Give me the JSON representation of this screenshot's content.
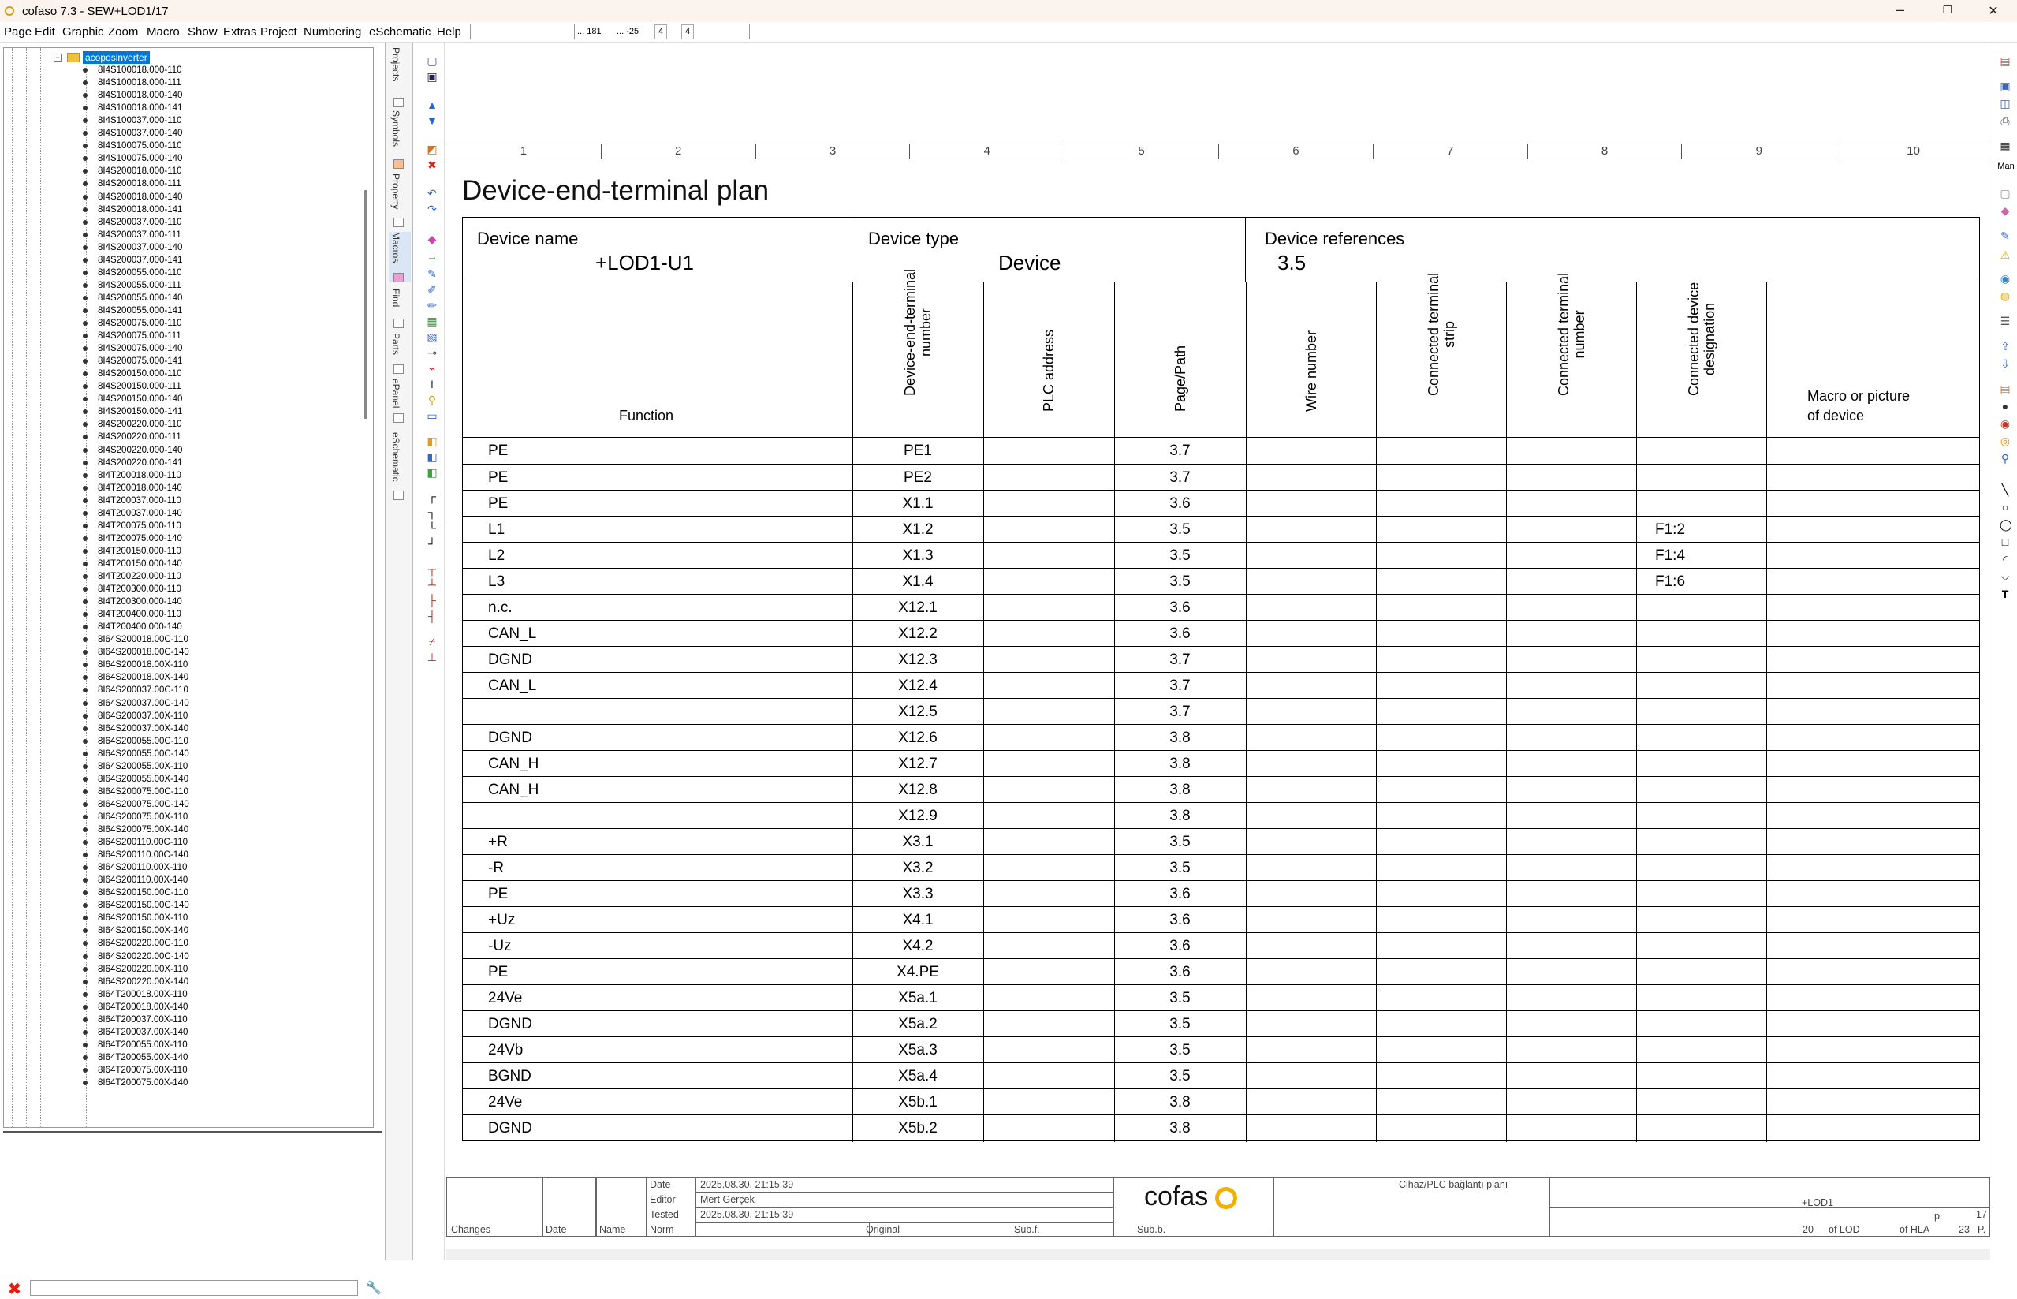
{
  "window": {
    "title": "cofaso 7.3 - SEW+LOD1/17",
    "minimize": "–",
    "maximize": "❐",
    "close": "✕"
  },
  "menu": {
    "items": [
      "Page",
      "Edit",
      "Graphic",
      "Zoom",
      "Macro",
      "Show",
      "Extras",
      "Project",
      "Numbering",
      "eSchematic",
      "Help"
    ],
    "coord_x": "... 181",
    "coord_y": "... -25",
    "grid_a": "4",
    "grid_b": "4"
  },
  "tree": {
    "root_label": "acoposinverter",
    "items": [
      "8I4S100018.000-110",
      "8I4S100018.000-111",
      "8I4S100018.000-140",
      "8I4S100018.000-141",
      "8I4S100037.000-110",
      "8I4S100037.000-140",
      "8I4S100075.000-110",
      "8I4S100075.000-140",
      "8I4S200018.000-110",
      "8I4S200018.000-111",
      "8I4S200018.000-140",
      "8I4S200018.000-141",
      "8I4S200037.000-110",
      "8I4S200037.000-111",
      "8I4S200037.000-140",
      "8I4S200037.000-141",
      "8I4S200055.000-110",
      "8I4S200055.000-111",
      "8I4S200055.000-140",
      "8I4S200055.000-141",
      "8I4S200075.000-110",
      "8I4S200075.000-111",
      "8I4S200075.000-140",
      "8I4S200075.000-141",
      "8I4S200150.000-110",
      "8I4S200150.000-111",
      "8I4S200150.000-140",
      "8I4S200150.000-141",
      "8I4S200220.000-110",
      "8I4S200220.000-111",
      "8I4S200220.000-140",
      "8I4S200220.000-141",
      "8I4T200018.000-110",
      "8I4T200018.000-140",
      "8I4T200037.000-110",
      "8I4T200037.000-140",
      "8I4T200075.000-110",
      "8I4T200075.000-140",
      "8I4T200150.000-110",
      "8I4T200150.000-140",
      "8I4T200220.000-110",
      "8I4T200300.000-110",
      "8I4T200300.000-140",
      "8I4T200400.000-110",
      "8I4T200400.000-140",
      "8I64S200018.00C-110",
      "8I64S200018.00C-140",
      "8I64S200018.00X-110",
      "8I64S200018.00X-140",
      "8I64S200037.00C-110",
      "8I64S200037.00C-140",
      "8I64S200037.00X-110",
      "8I64S200037.00X-140",
      "8I64S200055.00C-110",
      "8I64S200055.00C-140",
      "8I64S200055.00X-110",
      "8I64S200055.00X-140",
      "8I64S200075.00C-110",
      "8I64S200075.00C-140",
      "8I64S200075.00X-110",
      "8I64S200075.00X-140",
      "8I64S200110.00C-110",
      "8I64S200110.00C-140",
      "8I64S200110.00X-110",
      "8I64S200110.00X-140",
      "8I64S200150.00C-110",
      "8I64S200150.00C-140",
      "8I64S200150.00X-110",
      "8I64S200150.00X-140",
      "8I64S200220.00C-110",
      "8I64S200220.00C-140",
      "8I64S200220.00X-110",
      "8I64S200220.00X-140",
      "8I64T200018.00X-110",
      "8I64T200018.00X-140",
      "8I64T200037.00X-110",
      "8I64T200037.00X-140",
      "8I64T200055.00X-110",
      "8I64T200055.00X-140",
      "8I64T200075.00X-110",
      "8I64T200075.00X-140"
    ]
  },
  "side_tabs": [
    "Projects",
    "Symbols",
    "Property",
    "Macros",
    "Find",
    "Parts",
    "ePanel",
    "eSchematic"
  ],
  "right_toolbar_label": "Man",
  "sheet": {
    "column_numbers": [
      "1",
      "2",
      "3",
      "4",
      "5",
      "6",
      "7",
      "8",
      "9",
      "10"
    ],
    "title": "Device-end-terminal plan",
    "device_name_label": "Device name",
    "device_name": "+LOD1-U1",
    "device_type_label": "Device type",
    "device_type": "Device",
    "device_refs_label": "Device references",
    "device_refs": "3.5",
    "columns": {
      "function": "Function",
      "terminal_l1": "Device-end-terminal",
      "terminal_l2": "number",
      "plc": "PLC address",
      "page": "Page/Path",
      "wire": "Wire number",
      "strip_l1": "Connected terminal",
      "strip_l2": "strip",
      "cterm_l1": "Connected terminal",
      "cterm_l2": "number",
      "cdev_l1": "Connected device",
      "cdev_l2": "designation",
      "macro_l1": "Macro or picture",
      "macro_l2": "of device"
    },
    "rows": [
      {
        "function": "PE",
        "terminal": "PE1",
        "page": "3.7",
        "device": ""
      },
      {
        "function": "PE",
        "terminal": "PE2",
        "page": "3.7",
        "device": ""
      },
      {
        "function": "PE",
        "terminal": "X1.1",
        "page": "3.6",
        "device": ""
      },
      {
        "function": "L1",
        "terminal": "X1.2",
        "page": "3.5",
        "device": "F1:2"
      },
      {
        "function": "L2",
        "terminal": "X1.3",
        "page": "3.5",
        "device": "F1:4"
      },
      {
        "function": "L3",
        "terminal": "X1.4",
        "page": "3.5",
        "device": "F1:6"
      },
      {
        "function": "n.c.",
        "terminal": "X12.1",
        "page": "3.6",
        "device": ""
      },
      {
        "function": "CAN_L",
        "terminal": "X12.2",
        "page": "3.6",
        "device": ""
      },
      {
        "function": "DGND",
        "terminal": "X12.3",
        "page": "3.7",
        "device": ""
      },
      {
        "function": "CAN_L",
        "terminal": "X12.4",
        "page": "3.7",
        "device": ""
      },
      {
        "function": "",
        "terminal": "X12.5",
        "page": "3.7",
        "device": ""
      },
      {
        "function": "DGND",
        "terminal": "X12.6",
        "page": "3.8",
        "device": ""
      },
      {
        "function": "CAN_H",
        "terminal": "X12.7",
        "page": "3.8",
        "device": ""
      },
      {
        "function": "CAN_H",
        "terminal": "X12.8",
        "page": "3.8",
        "device": ""
      },
      {
        "function": "",
        "terminal": "X12.9",
        "page": "3.8",
        "device": ""
      },
      {
        "function": "+R",
        "terminal": "X3.1",
        "page": "3.5",
        "device": ""
      },
      {
        "function": "-R",
        "terminal": "X3.2",
        "page": "3.5",
        "device": ""
      },
      {
        "function": "PE",
        "terminal": "X3.3",
        "page": "3.6",
        "device": ""
      },
      {
        "function": "+Uz",
        "terminal": "X4.1",
        "page": "3.6",
        "device": ""
      },
      {
        "function": "-Uz",
        "terminal": "X4.2",
        "page": "3.6",
        "device": ""
      },
      {
        "function": "PE",
        "terminal": "X4.PE",
        "page": "3.6",
        "device": ""
      },
      {
        "function": "24Ve",
        "terminal": "X5a.1",
        "page": "3.5",
        "device": ""
      },
      {
        "function": "DGND",
        "terminal": "X5a.2",
        "page": "3.5",
        "device": ""
      },
      {
        "function": "24Vb",
        "terminal": "X5a.3",
        "page": "3.5",
        "device": ""
      },
      {
        "function": "BGND",
        "terminal": "X5a.4",
        "page": "3.5",
        "device": ""
      },
      {
        "function": "24Ve",
        "terminal": "X5b.1",
        "page": "3.8",
        "device": ""
      },
      {
        "function": "DGND",
        "terminal": "X5b.2",
        "page": "3.8",
        "device": ""
      }
    ]
  },
  "title_block": {
    "date_label": "Date",
    "date_value": "2025.08.30, 21:15:39",
    "editor_label": "Editor",
    "editor_value": "Mert Gerçek",
    "tested_label": "Tested",
    "tested_value": "2025.08.30, 21:15:39",
    "changes": "Changes",
    "date": "Date",
    "name": "Name",
    "norm": "Norm",
    "original": "Original",
    "subf": "Sub.f.",
    "subb": "Sub.b.",
    "logo": "cofas",
    "description": "Cihaz/PLC bağlantı planı",
    "plant": "+LOD1",
    "p_label": "p.",
    "p_value": "17",
    "of_lod_num": "20",
    "of_lod": "of LOD",
    "of_hla": "of HLA",
    "p2_num": "23",
    "p2_label": "P."
  }
}
